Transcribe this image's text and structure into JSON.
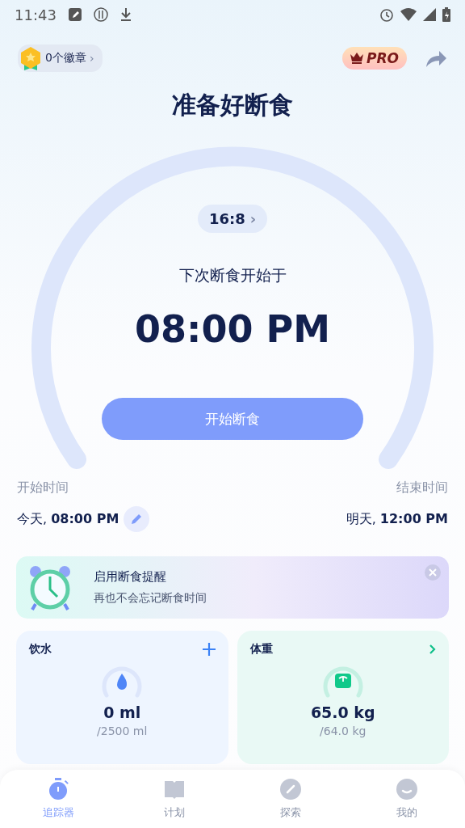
{
  "status_bar": {
    "time": "11:43"
  },
  "badges": {
    "label": "0个徽章",
    "chevron": "›"
  },
  "pro": {
    "label": "PRO"
  },
  "title": "准备好断食",
  "dial": {
    "plan": "16:8",
    "chevron": "›",
    "caption": "下次断食开始于",
    "time": "08:00 PM",
    "button": "开始断食"
  },
  "times": {
    "start_label": "开始时间",
    "start_day": "今天,",
    "start_time": "08:00 PM",
    "end_label": "结束时间",
    "end_day": "明天,",
    "end_time": "12:00 PM"
  },
  "reminder": {
    "title": "启用断食提醒",
    "subtitle": "再也不会忘记断食时间"
  },
  "cards": [
    {
      "kind": "water",
      "title": "饮水",
      "value": "0 ml",
      "goal": "/2500 ml"
    },
    {
      "kind": "weight",
      "title": "体重",
      "value": "65.0 kg",
      "goal": "/64.0 kg"
    }
  ],
  "tabs": [
    {
      "kind": "tracker",
      "label": "追踪器",
      "selected": true
    },
    {
      "kind": "plan",
      "label": "计划",
      "selected": false
    },
    {
      "kind": "explore",
      "label": "探索",
      "selected": false
    },
    {
      "kind": "me",
      "label": "我的",
      "selected": false
    }
  ]
}
